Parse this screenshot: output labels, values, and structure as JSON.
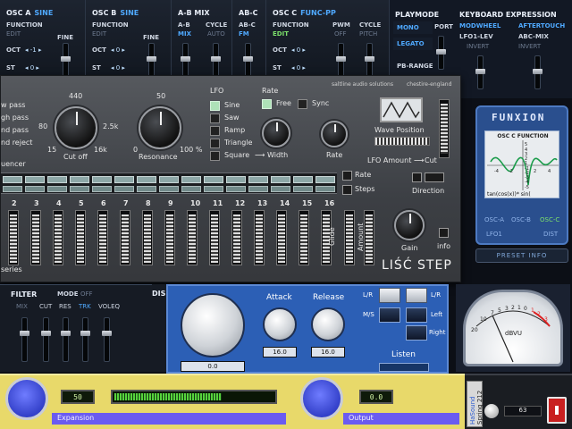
{
  "top": {
    "osc_a": {
      "title": "OSC A",
      "wave": "SINE",
      "function": "FUNCTION",
      "edit": "EDIT",
      "oct": "OCT",
      "oct_val": "◂ -1 ▸",
      "fine": "FINE",
      "st": "ST",
      "st_val": "◂ 0 ▸"
    },
    "osc_b": {
      "title": "OSC B",
      "wave": "SINE",
      "function": "FUNCTION",
      "edit": "EDIT",
      "oct": "OCT",
      "oct_val": "◂ 0 ▸",
      "fine": "FINE",
      "st": "ST",
      "st_val": "◂ 0 ▸"
    },
    "ab_mix": {
      "title": "A-B MIX",
      "ab": "A-B",
      "mix": "MIX",
      "cycle": "CYCLE",
      "auto": "AUTO"
    },
    "ab_c": {
      "title": "AB-C",
      "ab_c_label": "AB-C",
      "fm": "FM"
    },
    "osc_c": {
      "title": "OSC C",
      "wave": "FUNC-PP",
      "function": "FUNCTION",
      "edit": "EDIT",
      "pwm": "PWM",
      "off": "OFF",
      "cycle": "CYCLE",
      "pitch": "PITCH",
      "oct": "OCT",
      "oct_val": "◂ 0 ▸",
      "st": "ST",
      "st_val": "◂ 0 ▸"
    },
    "playmode": {
      "title": "PLAYMODE",
      "mono": "MONO",
      "port": "PORT",
      "legato": "LEGATO",
      "pb_range": "PB-RANGE"
    },
    "keyboard": {
      "title": "KEYBOARD EXPRESSION",
      "modwheel": "MODWHEEL",
      "aftertouch": "AFTERTOUCH",
      "lfo1_lev": "LFO1-LEV",
      "abc_mix": "ABC-MIX",
      "invert1": "INVERT",
      "invert2": "INVERT"
    }
  },
  "funxion": {
    "logo": "FUNXION",
    "screen_title": "OSC C FUNCTION",
    "formula": "tan(cos(x))* sin(",
    "tabs": [
      "OSC-A",
      "OSC-B",
      "OSC-C"
    ],
    "bottom_tabs": [
      "LFO1",
      "DIST"
    ],
    "axis_ticks": [
      "-4",
      "-2",
      "2",
      "4",
      "5",
      "4",
      "3",
      "2",
      "1",
      "-1",
      "-2",
      "-3",
      "-4",
      "-5"
    ]
  },
  "preset": {
    "label": "PRESET INFO"
  },
  "lisc": {
    "brand": "saltline audio solutions",
    "location": "chestire-england",
    "filter_types": [
      "w pass",
      "gh pass",
      "nd pass",
      "nd reject"
    ],
    "cutoff_ticks": [
      "440",
      "80",
      "2.5k",
      "15",
      "16k"
    ],
    "cutoff_label": "Cut off",
    "res_ticks": [
      "50",
      "0",
      "100 %"
    ],
    "res_label": "Resonance",
    "lfo_label": "LFO",
    "waves": [
      "Sine",
      "Saw",
      "Ramp",
      "Triangle",
      "Square"
    ],
    "width_label": "Width",
    "rate_label": "Rate",
    "free_label": "Free",
    "sync_label": "Sync",
    "rate_knob_label": "Rate",
    "wave_position": "Wave Position",
    "lfo_amount": "LFO Amount",
    "cut_arrow": "Cut",
    "step_rate": "Rate",
    "step_steps": "Steps",
    "direction": "Direction",
    "sequencer": "uencer",
    "series": "series",
    "step_numbers": [
      "2",
      "3",
      "4",
      "5",
      "6",
      "7",
      "8",
      "9",
      "10",
      "11",
      "12",
      "13",
      "14",
      "15",
      "16"
    ],
    "glide": "Glide",
    "amount": "Amount",
    "gain": "Gain",
    "info": "info",
    "title": "LIŚĆ STEP"
  },
  "filter_section": {
    "filter": "FILTER",
    "mode": "MODE",
    "mode_val": "OFF",
    "cols": [
      "MIX",
      "CUT",
      "RES",
      "TRK",
      "VOLEQ"
    ],
    "dist_partial": "DIS"
  },
  "dynamics": {
    "attack": "Attack",
    "release": "Release",
    "main_value": "0.0",
    "attack_value": "16.0",
    "release_value": "16.0",
    "lr": "L/R",
    "ms": "M/S",
    "lr2": "L/R",
    "left": "Left",
    "right": "Right",
    "listen": "Listen"
  },
  "vu": {
    "scale": [
      "20",
      "10",
      "7",
      "5",
      "3",
      "2",
      "1",
      "0",
      "1",
      "2",
      "3"
    ],
    "unit": "dBVU"
  },
  "expansion": {
    "exp_label": "Expansion",
    "exp_value": "50",
    "out_label": "Output",
    "out_value": "0.0",
    "meter_level": 0.66
  },
  "spring": {
    "label": "Spring 212",
    "brand": "HaSound",
    "value": "63"
  },
  "colors": {
    "accent_blue": "#4fa9ff",
    "accent_green": "#7ce06b",
    "lisc_body": "#4a4d52",
    "dyn_panel": "#2c5fb5",
    "yellow_panel": "#e8d96a"
  }
}
